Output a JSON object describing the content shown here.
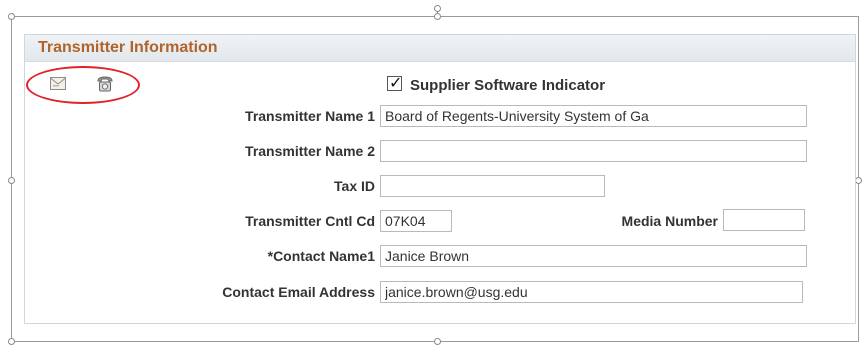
{
  "panel": {
    "title": "Transmitter Information"
  },
  "toolbar": {
    "icons": [
      "envelope-icon",
      "telephone-icon"
    ],
    "highlight_color": "#e0222a"
  },
  "supplier_software": {
    "label": "Supplier Software Indicator",
    "checked": true
  },
  "fields": {
    "transmitter_name_1": {
      "label": "Transmitter Name 1",
      "value": "Board of Regents-University System of Ga"
    },
    "transmitter_name_2": {
      "label": "Transmitter Name 2",
      "value": ""
    },
    "tax_id": {
      "label": "Tax ID",
      "value": ""
    },
    "transmitter_cntl_cd": {
      "label": "Transmitter Cntl Cd",
      "value": "07K04"
    },
    "media_number": {
      "label": "Media Number",
      "value": ""
    },
    "contact_name1": {
      "label": "*Contact Name1",
      "value": "Janice Brown"
    },
    "contact_email": {
      "label": "Contact Email Address",
      "value": "janice.brown@usg.edu"
    }
  },
  "colors": {
    "title": "#b0642a",
    "header_bg": "#e6ebef",
    "label": "#333333"
  }
}
